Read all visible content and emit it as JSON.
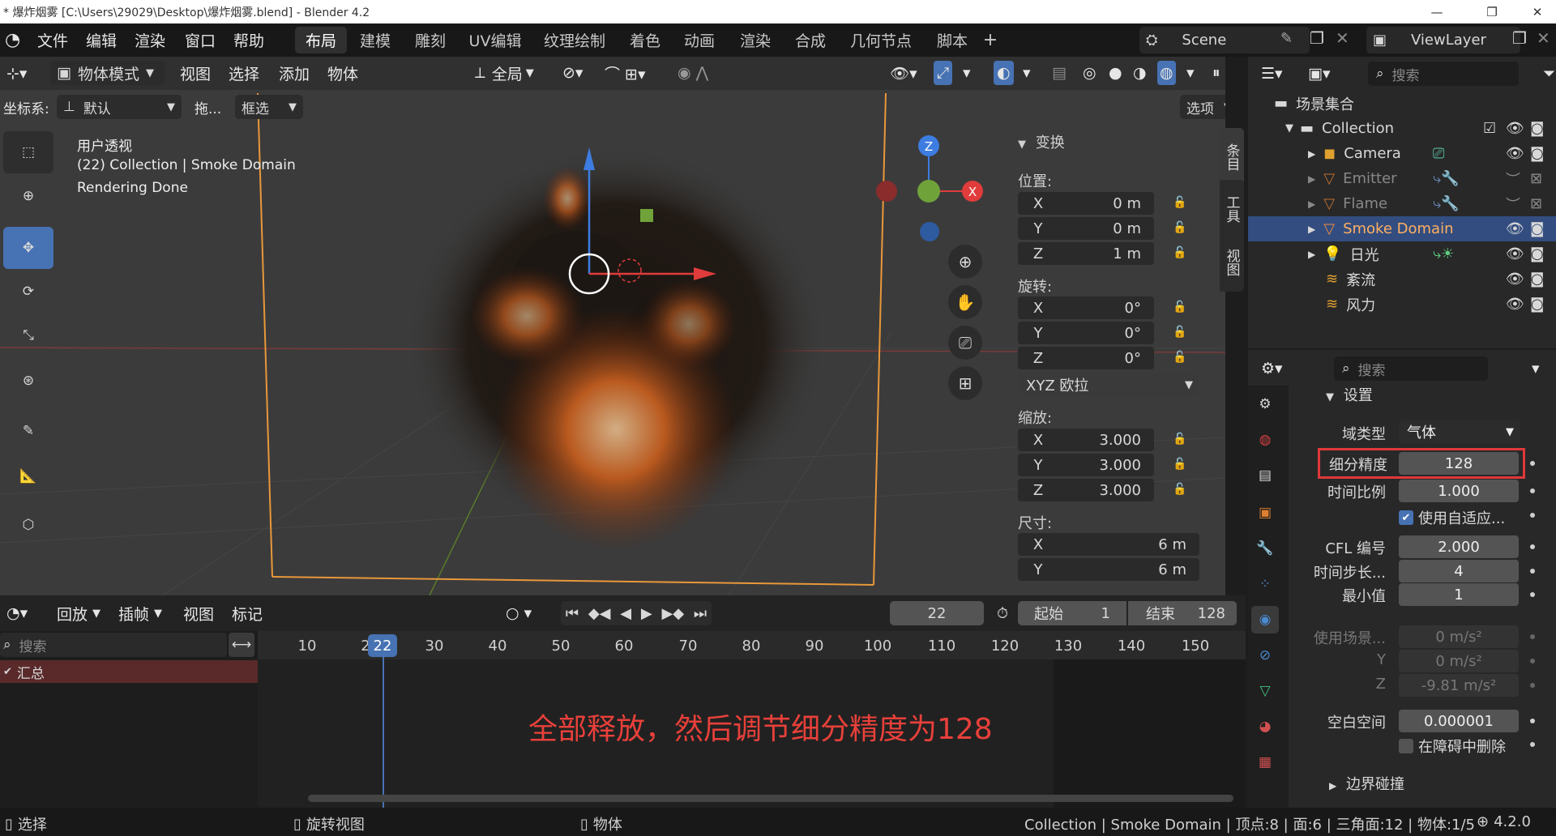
{
  "window": {
    "title": "* 爆炸烟雾 [C:\\Users\\29029\\Desktop\\爆炸烟雾.blend] - Blender 4.2"
  },
  "menu": [
    "文件",
    "编辑",
    "渲染",
    "窗口",
    "帮助"
  ],
  "workspaces": [
    "布局",
    "建模",
    "雕刻",
    "UV编辑",
    "纹理绘制",
    "着色",
    "动画",
    "渲染",
    "合成",
    "几何节点",
    "脚本"
  ],
  "scene": {
    "name": "Scene",
    "view_layer": "ViewLayer"
  },
  "viewport": {
    "mode": "物体模式",
    "menus": [
      "视图",
      "选择",
      "添加",
      "物体"
    ],
    "orientation_label": "坐标系:",
    "orientation_value": "默认",
    "drag_label": "拖...",
    "select_mode": "框选",
    "transform_space": "全局",
    "options_label": "选项",
    "info_view": "用户透视",
    "info_object": "(22) Collection | Smoke Domain",
    "info_status": "Rendering Done",
    "gizmo": {
      "z": "Z",
      "x": "X"
    }
  },
  "npanel": {
    "section": "变换",
    "location_label": "位置:",
    "location": [
      {
        "axis": "X",
        "value": "0 m"
      },
      {
        "axis": "Y",
        "value": "0 m"
      },
      {
        "axis": "Z",
        "value": "1 m"
      }
    ],
    "rotation_label": "旋转:",
    "rotation": [
      {
        "axis": "X",
        "value": "0°"
      },
      {
        "axis": "Y",
        "value": "0°"
      },
      {
        "axis": "Z",
        "value": "0°"
      }
    ],
    "rotation_mode": "XYZ 欧拉",
    "scale_label": "缩放:",
    "scale": [
      {
        "axis": "X",
        "value": "3.000"
      },
      {
        "axis": "Y",
        "value": "3.000"
      },
      {
        "axis": "Z",
        "value": "3.000"
      }
    ],
    "dimensions_label": "尺寸:",
    "dimensions": [
      {
        "axis": "X",
        "value": "6 m"
      },
      {
        "axis": "Y",
        "value": "6 m"
      }
    ],
    "tabs": [
      "条目",
      "工具",
      "视图"
    ]
  },
  "timeline": {
    "menus": [
      "回放",
      "插帧",
      "视图",
      "标记"
    ],
    "current_frame": "22",
    "start_label": "起始",
    "start": "1",
    "end_label": "结束",
    "end": "128",
    "search_placeholder": "搜索",
    "summary": "汇总",
    "ruler": [
      "10",
      "30",
      "40",
      "50",
      "60",
      "70",
      "80",
      "90",
      "100",
      "110",
      "120",
      "130",
      "140",
      "150"
    ],
    "ruler_partial": "2",
    "annotation": "全部释放，然后调节细分精度为128"
  },
  "outliner": {
    "search_placeholder": "搜索",
    "root": "场景集合",
    "collection": "Collection",
    "items": [
      "Camera",
      "Emitter",
      "Flame",
      "Smoke Domain",
      "日光",
      "紊流",
      "风力"
    ]
  },
  "properties": {
    "search_placeholder": "搜索",
    "section": "设置",
    "domain_type_label": "域类型",
    "domain_type": "气体",
    "resolution_label": "细分精度",
    "resolution": "128",
    "time_scale_label": "时间比例",
    "time_scale": "1.000",
    "adaptive_label": "使用自适应...",
    "cfl_label": "CFL 编号",
    "cfl": "2.000",
    "timesteps_label": "时间步长...",
    "timesteps": "4",
    "min_label": "最小值",
    "min": "1",
    "gravity_label": "使用场景...",
    "gravity_x": "0 m/s²",
    "gravity_y_label": "Y",
    "gravity_y": "0 m/s²",
    "gravity_z_label": "Z",
    "gravity_z": "-9.81 m/s²",
    "empty_space_label": "空白空间",
    "empty_space": "0.000001",
    "delete_obstacle_label": "在障碍中删除",
    "border_collision": "边界碰撞",
    "highlight_color": "#e0383a"
  },
  "status": {
    "select": "选择",
    "rotate": "旋转视图",
    "object": "物体",
    "stats": "Collection | Smoke Domain | 顶点:8 | 面:6 | 三角面:12 | 物体:1/5",
    "version": "4.2.0"
  }
}
